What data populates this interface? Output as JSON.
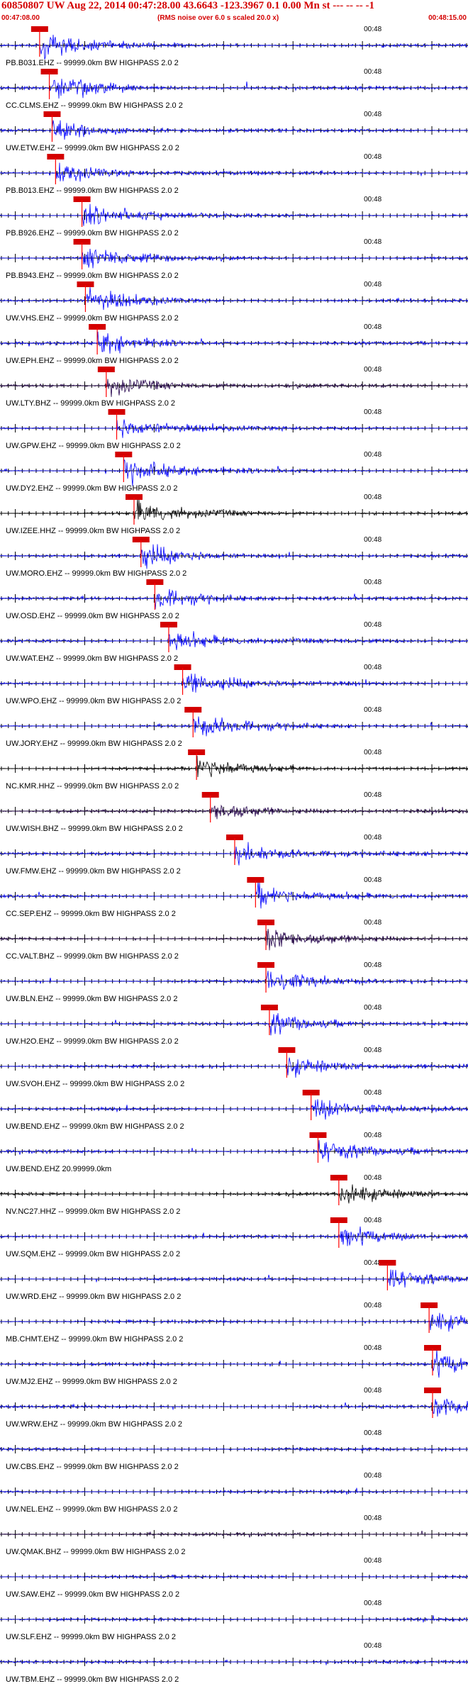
{
  "header": {
    "title": "60850807 UW Aug 22, 2014 00:47:28.00   43.6643 -123.3967  0.1 0.00 Mn st --- -- --  -1",
    "start_time": "00:47:08.00",
    "note": "(RMS noise over 6.0 s scaled 20.0 x)",
    "end_time": "00:48:15.00"
  },
  "colors": {
    "header_text": "#d40000",
    "trace_blue": "#0000ff",
    "trace_black": "#000000",
    "trace_dark": "#22004a",
    "pick_marker": "#d40000",
    "pick_line": "#ff0000",
    "axis": "#000000",
    "background": "#ffffff"
  },
  "chart_data": {
    "type": "line",
    "title": "60850807 UW Aug 22, 2014 00:47:28.00   43.6643 -123.3967  0.1 0.00 Mn st --- -- --  -1",
    "subtitle": "(RMS noise over 6.0 s scaled 20.0 x)",
    "x_start": "00:47:08.00",
    "x_end": "00:48:15.00",
    "xlim_seconds": [
      0,
      67
    ],
    "minute_mark_label": "00:48",
    "minute_mark_seconds": 52,
    "grid": false,
    "traces": [
      {
        "label": "PB.B031.EHZ -- 99999.0km BW  HIGHPASS  2.0  2",
        "pick_s": 5.5,
        "color": "trace_blue"
      },
      {
        "label": "CC.CLMS.EHZ -- 99999.0km BW  HIGHPASS  2.0  2",
        "pick_s": 6.9,
        "color": "trace_blue"
      },
      {
        "label": "UW.ETW.EHZ -- 99999.0km BW  HIGHPASS  2.0  2",
        "pick_s": 7.3,
        "color": "trace_blue"
      },
      {
        "label": "PB.B013.EHZ -- 99999.0km BW  HIGHPASS  2.0  2",
        "pick_s": 7.8,
        "color": "trace_blue"
      },
      {
        "label": "PB.B926.EHZ -- 99999.0km BW  HIGHPASS  2.0  2",
        "pick_s": 11.6,
        "color": "trace_blue"
      },
      {
        "label": "PB.B943.EHZ -- 99999.0km BW  HIGHPASS  2.0  2",
        "pick_s": 11.6,
        "color": "trace_blue"
      },
      {
        "label": "UW.VHS.EHZ -- 99999.0km BW  HIGHPASS  2.0  2",
        "pick_s": 12.1,
        "color": "trace_blue"
      },
      {
        "label": "UW.EPH.EHZ -- 99999.0km BW  HIGHPASS  2.0  2",
        "pick_s": 13.8,
        "color": "trace_blue"
      },
      {
        "label": "UW.LTY.BHZ -- 99999.0km BW  HIGHPASS  2.0  2",
        "pick_s": 15.1,
        "color": "trace_dark"
      },
      {
        "label": "UW.GPW.EHZ -- 99999.0km BW  HIGHPASS  2.0  2",
        "pick_s": 16.6,
        "color": "trace_blue"
      },
      {
        "label": "UW.DY2.EHZ -- 99999.0km BW  HIGHPASS  2.0  2",
        "pick_s": 17.6,
        "color": "trace_blue"
      },
      {
        "label": "UW.IZEE.HHZ -- 99999.0km BW  HIGHPASS  2.0  2",
        "pick_s": 19.1,
        "color": "trace_black"
      },
      {
        "label": "UW.MORO.EHZ -- 99999.0km BW  HIGHPASS  2.0  2",
        "pick_s": 20.1,
        "color": "trace_blue"
      },
      {
        "label": "UW.OSD.EHZ -- 99999.0km BW  HIGHPASS  2.0  2",
        "pick_s": 22.1,
        "color": "trace_blue"
      },
      {
        "label": "UW.WAT.EHZ -- 99999.0km BW  HIGHPASS  2.0  2",
        "pick_s": 24.1,
        "color": "trace_blue"
      },
      {
        "label": "UW.WPO.EHZ -- 99999.0km BW  HIGHPASS  2.0  2",
        "pick_s": 26.1,
        "color": "trace_blue"
      },
      {
        "label": "UW.JORY.EHZ -- 99999.0km BW  HIGHPASS  2.0  2",
        "pick_s": 27.6,
        "color": "trace_blue"
      },
      {
        "label": "NC.KMR.HHZ -- 99999.0km BW  HIGHPASS  2.0  2",
        "pick_s": 28.1,
        "color": "trace_black"
      },
      {
        "label": "UW.WISH.BHZ -- 99999.0km BW  HIGHPASS  2.0  2",
        "pick_s": 30.1,
        "color": "trace_dark"
      },
      {
        "label": "UW.FMW.EHZ -- 99999.0km BW  HIGHPASS  2.0  2",
        "pick_s": 33.6,
        "color": "trace_blue"
      },
      {
        "label": "CC.SEP.EHZ -- 99999.0km BW  HIGHPASS  2.0  2",
        "pick_s": 36.6,
        "color": "trace_blue"
      },
      {
        "label": "CC.VALT.BHZ -- 99999.0km BW  HIGHPASS  2.0  2",
        "pick_s": 38.1,
        "color": "trace_dark"
      },
      {
        "label": "UW.BLN.EHZ -- 99999.0km BW  HIGHPASS  2.0  2",
        "pick_s": 38.1,
        "color": "trace_blue"
      },
      {
        "label": "UW.H2O.EHZ -- 99999.0km BW  HIGHPASS  2.0  2",
        "pick_s": 38.6,
        "color": "trace_blue"
      },
      {
        "label": "UW.SVOH.EHZ -- 99999.0km BW  HIGHPASS  2.0  2",
        "pick_s": 41.1,
        "color": "trace_blue"
      },
      {
        "label": "UW.BEND.EHZ -- 99999.0km BW  HIGHPASS  2.0  2",
        "pick_s": 44.6,
        "color": "trace_blue"
      },
      {
        "label": "UW.BEND.EHZ 20.99999.0km",
        "pick_s": 45.6,
        "color": "trace_blue"
      },
      {
        "label": "NV.NC27.HHZ -- 99999.0km BW  HIGHPASS  2.0  2",
        "pick_s": 48.6,
        "color": "trace_black"
      },
      {
        "label": "UW.SQM.EHZ -- 99999.0km BW  HIGHPASS  2.0  2",
        "pick_s": 48.6,
        "color": "trace_blue"
      },
      {
        "label": "UW.WRD.EHZ -- 99999.0km BW  HIGHPASS  2.0  2",
        "pick_s": 55.6,
        "color": "trace_blue"
      },
      {
        "label": "MB.CHMT.EHZ -- 99999.0km BW  HIGHPASS  2.0  2",
        "pick_s": 61.6,
        "color": "trace_blue"
      },
      {
        "label": "UW.MJ2.EHZ -- 99999.0km BW  HIGHPASS  2.0  2",
        "pick_s": 62.1,
        "color": "trace_blue"
      },
      {
        "label": "UW.WRW.EHZ -- 99999.0km BW  HIGHPASS  2.0  2",
        "pick_s": 62.1,
        "color": "trace_blue"
      },
      {
        "label": "UW.CBS.EHZ -- 99999.0km BW  HIGHPASS  2.0  2",
        "pick_s": null,
        "color": "trace_blue"
      },
      {
        "label": "UW.NEL.EHZ -- 99999.0km BW  HIGHPASS  2.0  2",
        "pick_s": null,
        "color": "trace_blue"
      },
      {
        "label": "UW.QMAK.BHZ -- 99999.0km BW  HIGHPASS  2.0  2",
        "pick_s": null,
        "color": "trace_dark"
      },
      {
        "label": "UW.SAW.EHZ -- 99999.0km BW  HIGHPASS  2.0  2",
        "pick_s": null,
        "color": "trace_blue"
      },
      {
        "label": "UW.SLF.EHZ -- 99999.0km BW  HIGHPASS  2.0  2",
        "pick_s": null,
        "color": "trace_blue"
      },
      {
        "label": "UW.TBM.EHZ -- 99999.0km BW  HIGHPASS  2.0  2",
        "pick_s": null,
        "color": "trace_blue"
      }
    ]
  }
}
